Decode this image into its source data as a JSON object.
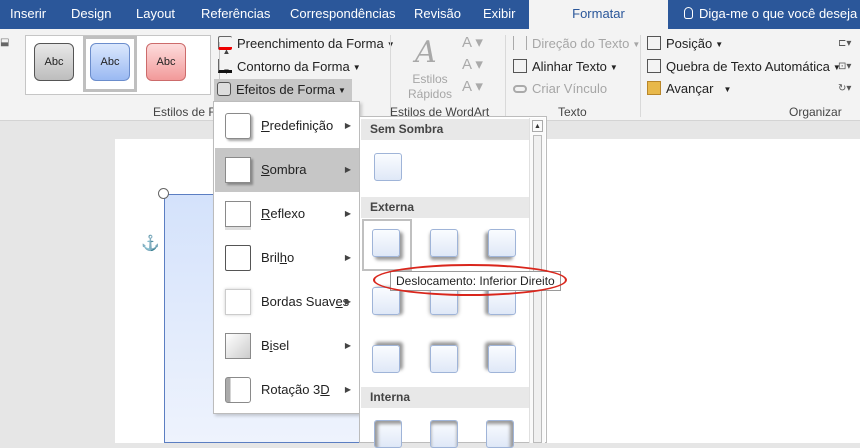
{
  "tabs": [
    "Inserir",
    "Design",
    "Layout",
    "Referências",
    "Correspondências",
    "Revisão",
    "Exibir",
    "Formatar"
  ],
  "tell_me": "Diga-me o que você deseja fazer",
  "shape_styles": {
    "samples": [
      "Abc",
      "Abc",
      "Abc"
    ],
    "fill": "Preenchimento da Forma",
    "outline": "Contorno da Forma",
    "effects": "Efeitos de Forma",
    "group_label": "Estilos de Fo"
  },
  "wordart": {
    "quick_styles": "Estilos Rápidos",
    "group_label": "Estilos de WordArt"
  },
  "text_group": {
    "direction": "Direção do Texto",
    "align": "Alinhar Texto",
    "link": "Criar Vínculo",
    "group_label": "Texto"
  },
  "arrange": {
    "position": "Posição",
    "wrap": "Quebra de Texto Automática",
    "forward": "Avançar",
    "group_label": "Organizar"
  },
  "effects_menu": [
    {
      "label": "Predefinição",
      "accel": "P"
    },
    {
      "label": "Sombra",
      "accel": "S"
    },
    {
      "label": "Reflexo",
      "accel": "R"
    },
    {
      "label": "Brilho",
      "accel": "h"
    },
    {
      "label": "Bordas Suaves",
      "accel": "e"
    },
    {
      "label": "Bisel",
      "accel": "i"
    },
    {
      "label": "Rotação 3D",
      "accel": "D"
    }
  ],
  "shadow_gallery": {
    "sections": [
      "Sem Sombra",
      "Externa",
      "Interna"
    ],
    "tooltip": "Deslocamento: Inferior Direito"
  },
  "colors": {
    "accent": "#2b579a",
    "highlight_ring": "#d9261c"
  }
}
